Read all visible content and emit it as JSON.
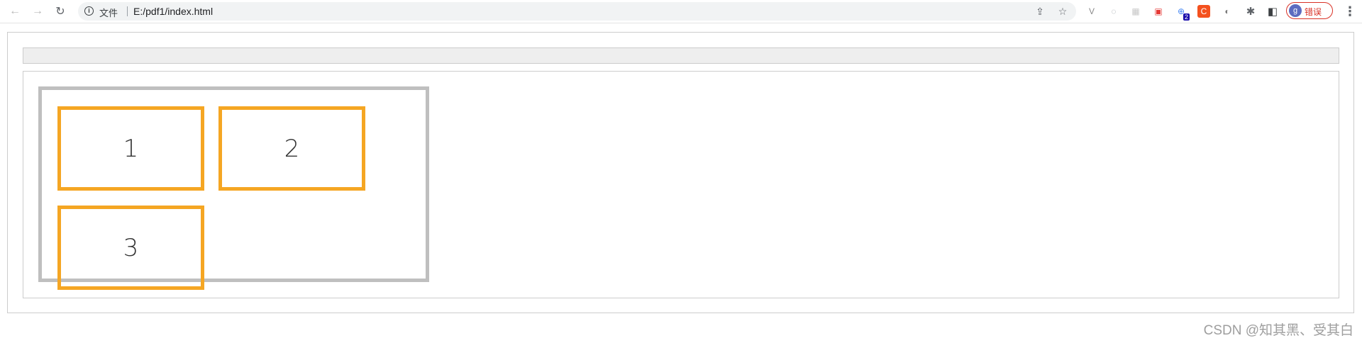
{
  "browser": {
    "back_icon": "←",
    "forward_icon": "→",
    "reload_icon": "↻",
    "info_icon": "i",
    "scheme_label": "文件",
    "url": "E:/pdf1/index.html",
    "share_icon": "⇪",
    "star_icon": "☆",
    "extensions": [
      {
        "name": "vue-devtools-icon",
        "glyph": "V",
        "color": "#8a8a8a"
      },
      {
        "name": "extension-2-icon",
        "glyph": "◌",
        "color": "#9aa0a6"
      },
      {
        "name": "extension-3-icon",
        "glyph": "▦",
        "color": "#c8c8c8"
      },
      {
        "name": "extension-4-icon",
        "glyph": "▣",
        "color": "#e53935"
      },
      {
        "name": "translate-icon",
        "glyph": "⊕",
        "color": "#4285f4",
        "badge": "2"
      },
      {
        "name": "csdn-extension-icon",
        "glyph": "C",
        "color": "#ffffff",
        "bg": "#f4511e"
      },
      {
        "name": "extension-7-icon",
        "glyph": "◐",
        "color": "#7a7a7a"
      }
    ],
    "puzzle_icon": "✱",
    "sidepanel_icon": "◧",
    "profile": {
      "initial": "g",
      "label": "错误"
    },
    "menu_icon": "⋮"
  },
  "page": {
    "items": [
      "1",
      "2",
      "3"
    ]
  },
  "watermark": "CSDN @知其黑、受其白",
  "colors": {
    "item_border": "#f5a623",
    "container_border": "#bfbfbf",
    "error": "#d93025"
  }
}
